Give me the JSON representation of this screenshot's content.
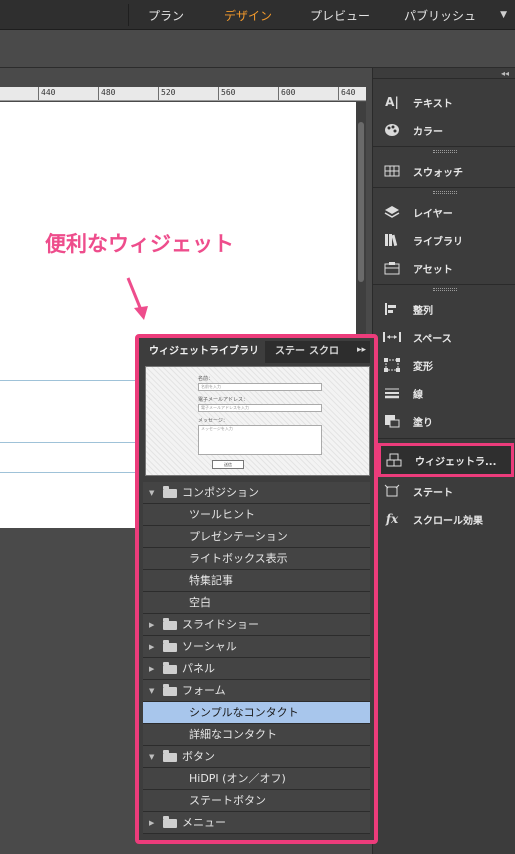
{
  "topbar": {
    "tabs": [
      {
        "label": "プラン"
      },
      {
        "label": "デザイン"
      },
      {
        "label": "プレビュー"
      },
      {
        "label": "パブリッシュ"
      }
    ],
    "active_tab": "デザイン",
    "accent": "#f39a2c"
  },
  "ruler": {
    "ticks": [
      "440",
      "480",
      "520",
      "560",
      "600",
      "640"
    ]
  },
  "callout": {
    "text": "便利なウィジェット",
    "color": "#ee4d8c"
  },
  "right_panel": {
    "items": [
      {
        "label": "テキスト",
        "icon": "text-icon"
      },
      {
        "label": "カラー",
        "icon": "palette-icon"
      },
      {
        "label": "スウォッチ",
        "icon": "swatches-icon"
      },
      {
        "label": "レイヤー",
        "icon": "layers-icon"
      },
      {
        "label": "ライブラリ",
        "icon": "library-icon"
      },
      {
        "label": "アセット",
        "icon": "assets-icon"
      },
      {
        "label": "整列",
        "icon": "align-icon"
      },
      {
        "label": "スペース",
        "icon": "spacing-icon"
      },
      {
        "label": "変形",
        "icon": "transform-icon"
      },
      {
        "label": "線",
        "icon": "stroke-icon"
      },
      {
        "label": "塗り",
        "icon": "fill-icon"
      },
      {
        "label": "ウィジェットラ...",
        "icon": "widget-library-icon"
      },
      {
        "label": "ステート",
        "icon": "states-icon"
      },
      {
        "label": "スクロール効果",
        "icon": "scroll-effects-icon"
      }
    ]
  },
  "widget_panel": {
    "tabs": [
      {
        "label": "ウィジェットライブラリ"
      },
      {
        "label": "ステー"
      },
      {
        "label": "スクロ"
      }
    ],
    "preview": {
      "name_label": "名前：",
      "name_placeholder": "名前を入力",
      "email_label": "電子メールアドレス：",
      "email_placeholder": "電子メールアドレスを入力",
      "message_label": "メッセージ：",
      "message_placeholder": "メッセージを入力",
      "submit_label": "送信"
    },
    "tree": [
      {
        "label": "コンポジション",
        "type": "folder",
        "expanded": true
      },
      {
        "label": "ツールヒント",
        "type": "child"
      },
      {
        "label": "プレゼンテーション",
        "type": "child"
      },
      {
        "label": "ライトボックス表示",
        "type": "child"
      },
      {
        "label": "特集記事",
        "type": "child"
      },
      {
        "label": "空白",
        "type": "child"
      },
      {
        "label": "スライドショー",
        "type": "folder",
        "expanded": false
      },
      {
        "label": "ソーシャル",
        "type": "folder",
        "expanded": false
      },
      {
        "label": "パネル",
        "type": "folder",
        "expanded": false
      },
      {
        "label": "フォーム",
        "type": "folder",
        "expanded": true
      },
      {
        "label": "シンプルなコンタクト",
        "type": "child",
        "selected": true
      },
      {
        "label": "詳細なコンタクト",
        "type": "child"
      },
      {
        "label": "ボタン",
        "type": "folder",
        "expanded": true
      },
      {
        "label": "HiDPI (オン／オフ)",
        "type": "child"
      },
      {
        "label": "ステートボタン",
        "type": "child"
      },
      {
        "label": "メニュー",
        "type": "folder",
        "expanded": false
      }
    ],
    "highlight_color": "#ec3c7b",
    "selection_color": "#a8c6ec"
  }
}
